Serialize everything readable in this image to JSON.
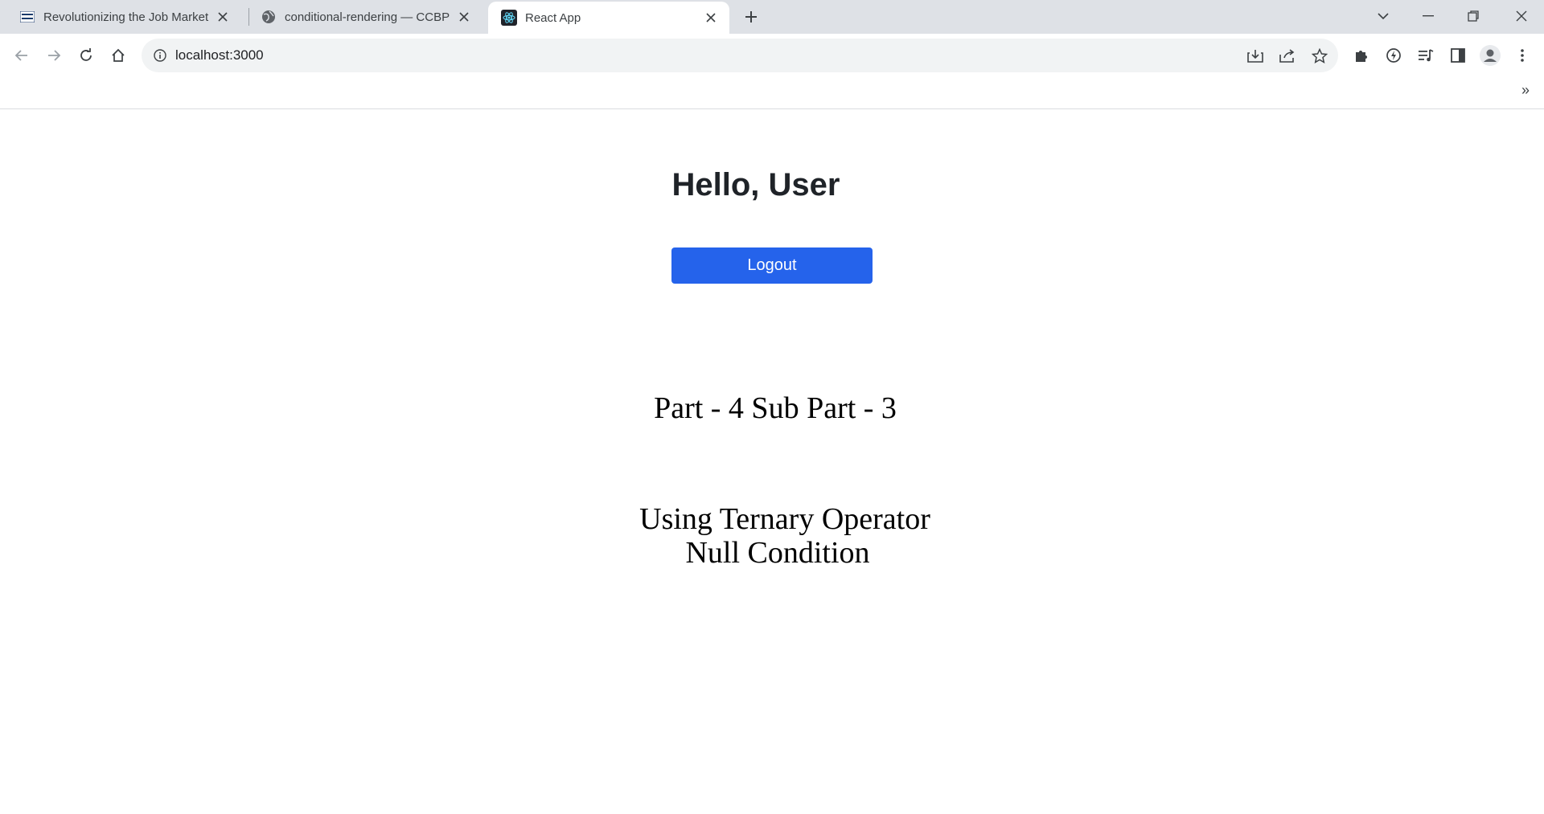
{
  "browser": {
    "tabs": [
      {
        "title": "Revolutionizing the Job Market |",
        "favicon": "nxtwave-logo-icon",
        "active": false
      },
      {
        "title": "conditional-rendering — CCBP ID",
        "favicon": "globe-icon",
        "active": false
      },
      {
        "title": "React App",
        "favicon": "react-logo-icon",
        "active": true
      }
    ],
    "address": "localhost:3000",
    "colors": {
      "tabstrip": "#dee1e6",
      "omnibox": "#f1f3f4"
    }
  },
  "page": {
    "greeting": "Hello, User",
    "logout_label": "Logout",
    "part_heading": "Part - 4 Sub Part - 3",
    "line1": "Using Ternary Operator",
    "line2": "Null Condition",
    "colors": {
      "button": "#2563eb",
      "button_text": "#ffffff"
    }
  }
}
